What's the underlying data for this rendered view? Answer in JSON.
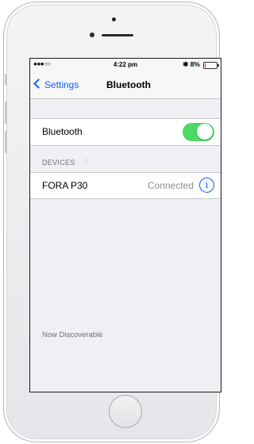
{
  "status_bar": {
    "signal": "●●●○○",
    "time": "4:22 pm",
    "bluetooth_battery": "✱ 8%",
    "battery_level": 0.08
  },
  "nav": {
    "back_label": "Settings",
    "title": "Bluetooth"
  },
  "bluetooth_row": {
    "label": "Bluetooth",
    "enabled": true
  },
  "devices_section": {
    "header": "DEVICES",
    "spinner": "⁘"
  },
  "devices": [
    {
      "name": "FORA P30",
      "status": "Connected",
      "info_icon": "i"
    }
  ],
  "footer": {
    "discoverable_text": "Now Discoverable"
  },
  "colors": {
    "accent": "#0a60ff",
    "toggle_on": "#4cd964",
    "background": "#efeff4"
  }
}
